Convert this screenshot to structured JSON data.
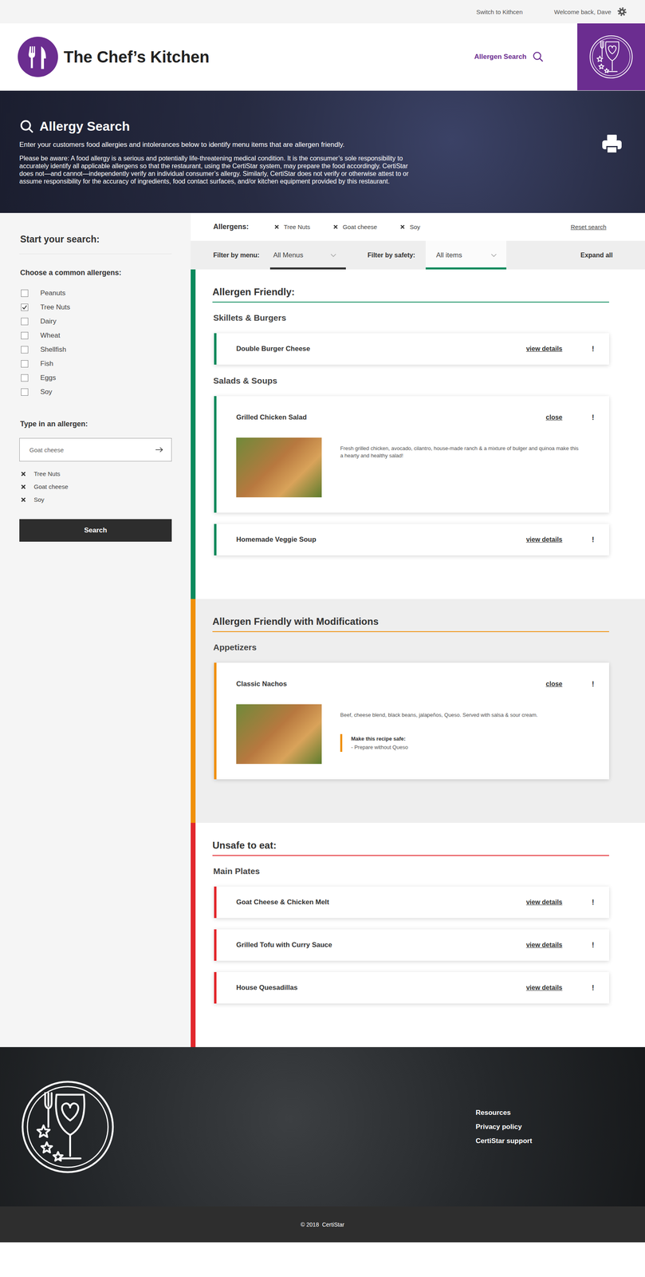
{
  "topbar": {
    "switch_link": "Switch to Kithcen",
    "welcome": "Welcome back, Dave"
  },
  "header": {
    "title": "The Chef’s Kitchen",
    "nav_link": "Allergen Search"
  },
  "hero": {
    "title": "Allergy Search",
    "intro": "Enter your customers food allergies and intolerances below to identify menu items that are allergen friendly.",
    "disclaimer": "Please be aware: A food allergy is a serious and potentially life-threatening medical condition. It is the consumer’s sole responsibility to accurately identify all applicable allergens so that the restaurant, using the CertiStar system, may prepare the food accordingly. CertiStar does not—and cannot—independently verify an individual consumer’s allergy. Similarly, CertiStar does not verify or otherwise attest to or assume responsibility for the accuracy of ingredients, food contact surfaces, and/or kitchen equipment provided by this restaurant."
  },
  "sidebar": {
    "heading": "Start your search:",
    "common_heading": "Choose a common allergens:",
    "common_allergens": [
      {
        "label": "Peanuts",
        "checked": false
      },
      {
        "label": "Tree Nuts",
        "checked": true
      },
      {
        "label": "Dairy",
        "checked": false
      },
      {
        "label": "Wheat",
        "checked": false
      },
      {
        "label": "Shellfish",
        "checked": false
      },
      {
        "label": "Fish",
        "checked": false
      },
      {
        "label": "Eggs",
        "checked": false
      },
      {
        "label": "Soy",
        "checked": false
      }
    ],
    "type_heading": "Type in an allergen:",
    "input_value": "Goat cheese",
    "selected_allergens": [
      "Tree Nuts",
      "Goat cheese",
      "Soy"
    ],
    "search_button": "Search"
  },
  "results": {
    "allergens_label": "Allergens:",
    "allergen_tags": [
      "Tree Nuts",
      "Goat cheese",
      "Soy"
    ],
    "reset": "Reset search",
    "filters": [
      {
        "label": "Filter by menu:",
        "value": "All Menus",
        "color": "#333333"
      },
      {
        "label": "Filter by safety:",
        "value": "All items",
        "color": "#0a8a5c"
      }
    ],
    "expand_all": "Expand all"
  },
  "sections": [
    {
      "title": "Allergen Friendly:",
      "kind": "safe",
      "color": "#0a8a5c",
      "categories": [
        {
          "name": "Skillets & Burgers",
          "items": [
            {
              "name": "Double Burger Cheese",
              "expanded": false,
              "action": "view details",
              "alert": "!"
            }
          ]
        },
        {
          "name": "Salads & Soups",
          "items": [
            {
              "name": "Grilled Chicken Salad",
              "expanded": true,
              "action": "close",
              "alert": "!",
              "description": "Fresh grilled chicken, avocado, cilantro, house-made ranch & a mixture of bulger and quinoa make this a hearty and healthy salad!"
            },
            {
              "name": "Homemade Veggie Soup",
              "expanded": false,
              "action": "view details",
              "alert": "!"
            }
          ]
        }
      ]
    },
    {
      "title": "Allergen Friendly with Modifications",
      "kind": "modified",
      "color": "#f0900a",
      "categories": [
        {
          "name": "Appetizers",
          "items": [
            {
              "name": "Classic Nachos",
              "expanded": true,
              "action": "close",
              "alert": "!",
              "description": "Beef, cheese blend, black beans, jalapeños, Queso. Served with salsa & sour cream.",
              "modification": {
                "heading": "Make this recipe safe:",
                "steps": [
                  "- Prepare without Queso"
                ]
              }
            }
          ]
        }
      ]
    },
    {
      "title": "Unsafe to eat:",
      "kind": "unsafe",
      "color": "#e2282d",
      "categories": [
        {
          "name": "Main Plates",
          "items": [
            {
              "name": "Goat Cheese & Chicken Melt",
              "expanded": false,
              "action": "view details",
              "alert": "!"
            },
            {
              "name": "Grilled Tofu with Curry Sauce",
              "expanded": false,
              "action": "view details",
              "alert": "!"
            },
            {
              "name": "House Quesadillas",
              "expanded": false,
              "action": "view details",
              "alert": "!"
            }
          ]
        }
      ]
    }
  ],
  "footer": {
    "links": [
      "Resources",
      "Privacy policy",
      "CertiStar support"
    ],
    "copyright": "© 2018  CertiStar"
  }
}
